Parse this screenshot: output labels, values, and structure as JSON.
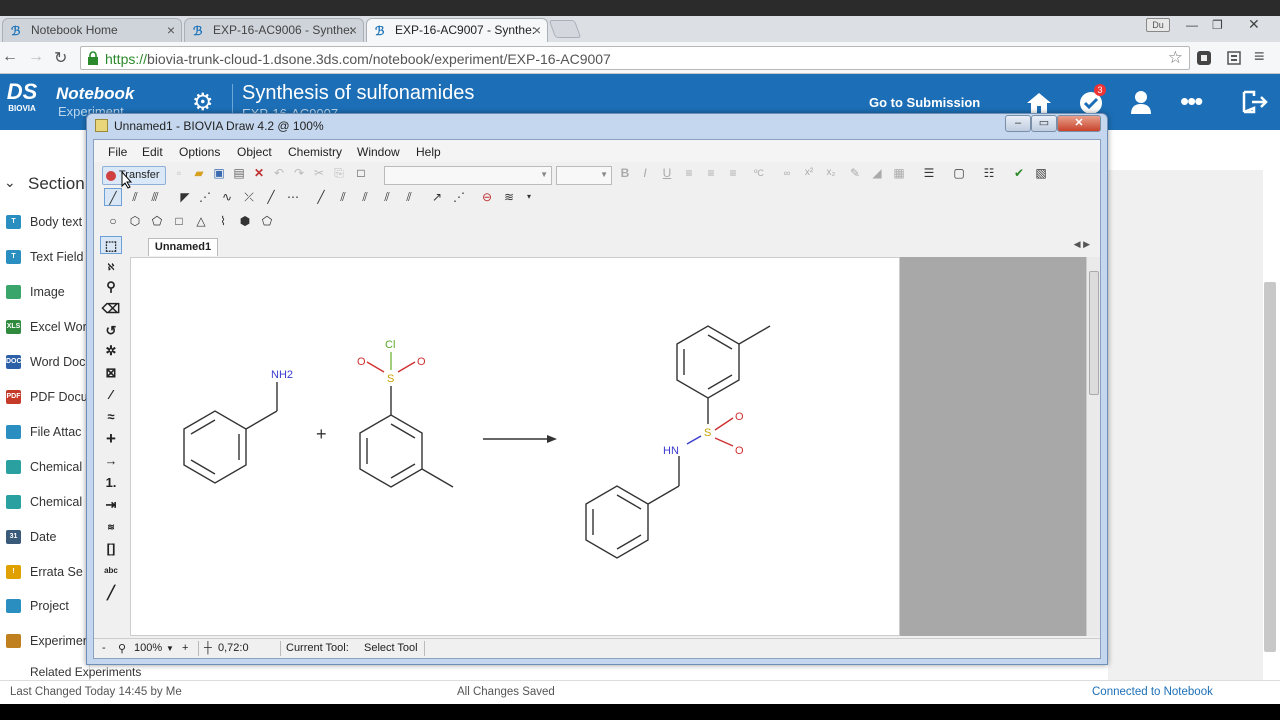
{
  "browser": {
    "tabs": [
      {
        "label": "Notebook Home",
        "icon": "ds-logo-icon"
      },
      {
        "label": "EXP-16-AC9006 - Synthe:",
        "icon": "ds-logo-icon"
      },
      {
        "label": "EXP-16-AC9007 - Synthe:",
        "icon": "ds-logo-icon"
      }
    ],
    "user_badge": "Du",
    "url_scheme": "https://",
    "url_rest": "biovia-trunk-cloud-1.dsone.3ds.com/notebook/experiment/EXP-16-AC9007"
  },
  "app": {
    "logo_mark": "DS",
    "logo_name": "BIOVIA",
    "name": "Notebook",
    "subtitle": "Experiment",
    "experiment_title": "Synthesis of sulfonamides",
    "experiment_id": "EXP-16-AC9007",
    "go_to_submission": "Go to Submission",
    "notification_count": "3"
  },
  "left_panel": {
    "section_label": "Section",
    "items": [
      {
        "label": "Body text",
        "icon_text": "T",
        "color": "#2a8fc0"
      },
      {
        "label": "Text Field",
        "icon_text": "T",
        "color": "#2a8fc0"
      },
      {
        "label": "Image",
        "icon_text": "",
        "color": "#3aa56a"
      },
      {
        "label": "Excel Wor",
        "icon_text": "XLS",
        "color": "#2f8a3e"
      },
      {
        "label": "Word Doc",
        "icon_text": "DOC",
        "color": "#2d5fa8"
      },
      {
        "label": "PDF Docu",
        "icon_text": "PDF",
        "color": "#c63a2a"
      },
      {
        "label": "File Attac",
        "icon_text": "",
        "color": "#2a8fc0"
      },
      {
        "label": "Chemical",
        "icon_text": "",
        "color": "#2aa0a0"
      },
      {
        "label": "Chemical",
        "icon_text": "",
        "color": "#2aa0a0"
      },
      {
        "label": "Date",
        "icon_text": "31",
        "color": "#3a5a7a"
      },
      {
        "label": "Errata Se",
        "icon_text": "!",
        "color": "#e0a000"
      },
      {
        "label": "Project",
        "icon_text": "",
        "color": "#2a8fc0"
      },
      {
        "label": "Experimen",
        "icon_text": "",
        "color": "#c08020"
      }
    ],
    "related": "Related Experiments"
  },
  "status": {
    "last_changed": "Last Changed Today 14:45 by Me",
    "saved": "All Changes Saved",
    "connected": "Connected to Notebook"
  },
  "draw": {
    "title": "Unnamed1 - BIOVIA Draw 4.2  @ 100%",
    "menu": [
      "File",
      "Edit",
      "Options",
      "Object",
      "Chemistry",
      "Window",
      "Help"
    ],
    "transfer_label": "Transfer",
    "doc_tab": "Unnamed1",
    "zoom": "100%",
    "coords": "0,72:0",
    "current_tool_label": "Current Tool:",
    "current_tool": "Select Tool"
  },
  "reaction": {
    "reactant1_group": "NH2",
    "reactant2_atoms": {
      "cl": "Cl",
      "s": "S",
      "o": "O"
    },
    "plus": "+",
    "product_atoms": {
      "s": "S",
      "o": "O",
      "nh": "HN"
    }
  }
}
